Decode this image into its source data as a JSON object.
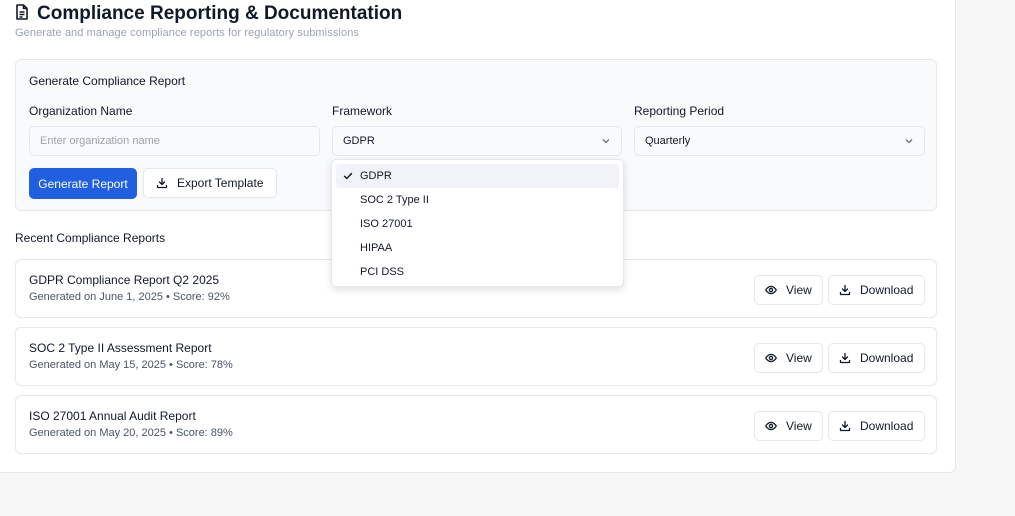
{
  "header": {
    "title": "Compliance Reporting & Documentation",
    "subtitle": "Generate and manage compliance reports for regulatory submissions",
    "icon": "document-icon"
  },
  "generate": {
    "title": "Generate Compliance Report",
    "org_label": "Organization Name",
    "org_placeholder": "Enter organization name",
    "org_value": "",
    "framework_label": "Framework",
    "framework_value": "GDPR",
    "period_label": "Reporting Period",
    "period_value": "Quarterly",
    "generate_button": "Generate Report",
    "export_button": "Export Template"
  },
  "framework_options": [
    {
      "label": "GDPR",
      "selected": true
    },
    {
      "label": "SOC 2 Type II",
      "selected": false
    },
    {
      "label": "ISO 27001",
      "selected": false
    },
    {
      "label": "HIPAA",
      "selected": false
    },
    {
      "label": "PCI DSS",
      "selected": false
    }
  ],
  "recent": {
    "title": "Recent Compliance Reports",
    "view_label": "View",
    "download_label": "Download",
    "reports": [
      {
        "name": "GDPR Compliance Report Q2 2025",
        "meta": "Generated on June 1, 2025 • Score: 92%"
      },
      {
        "name": "SOC 2 Type II Assessment Report",
        "meta": "Generated on May 15, 2025 • Score: 78%"
      },
      {
        "name": "ISO 27001 Annual Audit Report",
        "meta": "Generated on May 20, 2025 • Score: 89%"
      }
    ]
  },
  "colors": {
    "primary": "#1f5fe0",
    "border": "#e5e7eb",
    "muted_text": "#9ca3af"
  }
}
